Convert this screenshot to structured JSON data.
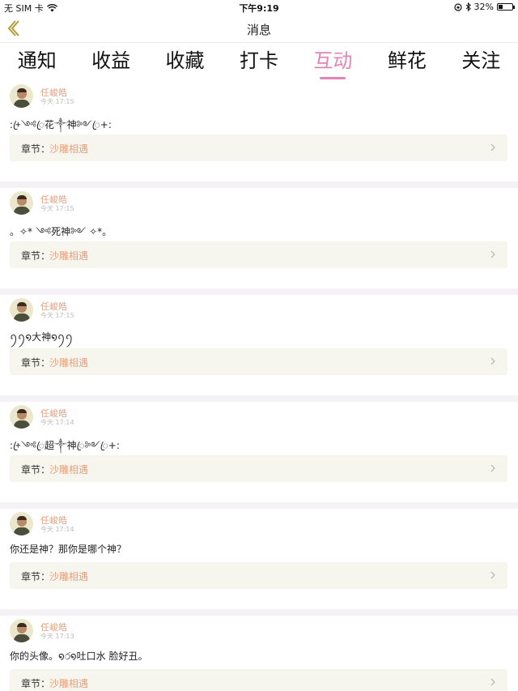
{
  "status_bar": {
    "carrier": "无 SIM 卡",
    "time": "下午9:19",
    "battery_text": "32%",
    "battery_level": 0.32
  },
  "nav": {
    "back_icon": "chevron-left-icon",
    "title": "消息"
  },
  "tabs": [
    {
      "label": "通知",
      "active": false
    },
    {
      "label": "收益",
      "active": false
    },
    {
      "label": "收藏",
      "active": false
    },
    {
      "label": "打卡",
      "active": false
    },
    {
      "label": "互动",
      "active": true
    },
    {
      "label": "鲜花",
      "active": false
    },
    {
      "label": "关注",
      "active": false
    }
  ],
  "accent_color": "#e383b6",
  "messages": [
    {
      "user": "任峻皓",
      "time": "今天 17:15",
      "content": ":+ꦿ༺ꦿ花༒神༻ꦿ+:",
      "chapter_label": "章节：",
      "chapter": "沙雕相遇"
    },
    {
      "user": "任峻皓",
      "time": "今天 17:15",
      "content": "。✧* ༺死神༻ ✧*。",
      "chapter_label": "章节：",
      "chapter": "沙雕相遇"
    },
    {
      "user": "任峻皓",
      "time": "今天 17:15",
      "content": "ꪆꪆ໑大神໑ꪆꪆ",
      "chapter_label": "章节：",
      "chapter": "沙雕相遇"
    },
    {
      "user": "任峻皓",
      "time": "今天 17:14",
      "content": ":+ꦿ༺ꦿ超༒神ꦿ༻ꦿ+:",
      "chapter_label": "章节：",
      "chapter": "沙雕相遇"
    },
    {
      "user": "任峻皓",
      "time": "今天 17:14",
      "content": "你还是神？那你是哪个神？",
      "chapter_label": "章节：",
      "chapter": "沙雕相遇"
    },
    {
      "user": "任峻皓",
      "time": "今天 17:13",
      "content": "你的头像。໑ර໑吐口水 脸好丑。",
      "chapter_label": "章节：",
      "chapter": "沙雕相遇"
    }
  ]
}
